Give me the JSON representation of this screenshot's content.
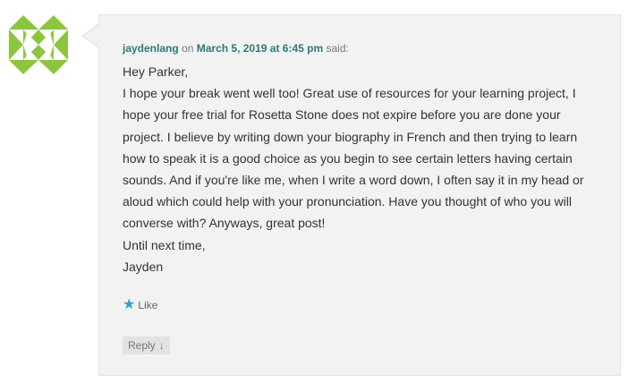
{
  "comment": {
    "author": "jaydenlang",
    "on_word": "on",
    "date": "March 5, 2019 at 6:45 pm",
    "said_word": "said:",
    "lines": [
      "Hey Parker,",
      "I hope your break went well too! Great use of resources for your learning project, I",
      "hope your free trial for Rosetta Stone does not expire before you are done your",
      "project. I believe by writing down your biography in French and then trying to learn",
      "how to speak it is a good choice as you begin to see certain letters having certain",
      "sounds. And if you're like me, when I write a word down, I often say it in my head or",
      "aloud which could help with your pronunciation. Have you thought of who you will",
      "converse with? Anyways, great post!",
      "Until next time,",
      "Jayden"
    ],
    "like_label": "Like",
    "reply_label": "Reply",
    "reply_arrow": "↓"
  },
  "icons": {
    "like": "star-icon",
    "avatar": "identicon-avatar"
  },
  "colors": {
    "avatar_green": "#8cc63f",
    "link": "#2b7a78",
    "like_star": "#2ea2cc",
    "box_bg": "#f2f2f2"
  }
}
